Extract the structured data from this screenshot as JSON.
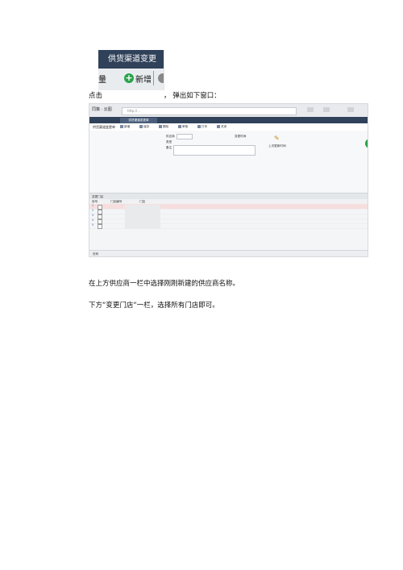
{
  "crop": {
    "tab_label": "供货渠道变更单",
    "edge_char": "量",
    "add_label": "新增",
    "plus_icon": "+"
  },
  "line1": {
    "prefix": "点击",
    "suffix": "，   弹出如下窗口："
  },
  "screenshot": {
    "brand": "同策 · 云图",
    "url": "http://...",
    "tab": "供货渠道变更单",
    "page_title": "供货渠道变更单",
    "tools": [
      "新增",
      "保存",
      "删除",
      "审核",
      "打印",
      "关闭"
    ],
    "form": {
      "supplier_label": "供应商",
      "type_label": "类型",
      "remark_label": "备注",
      "right_label": "变更时间",
      "icon_caption": "上次更新时间"
    },
    "grid_title": "变更门店",
    "grid_columns": [
      "序号",
      "门店编号",
      "门店"
    ],
    "row_numbers": [
      "1",
      "2",
      "3",
      "4",
      "5"
    ],
    "status": "页码"
  },
  "line2": "在上方供应商一栏中选择刚刚新建的供应商名称。",
  "line3": "下方“变更门店“一栏，选择所有门店即可。",
  "colors": {
    "header_navy": "#30415a",
    "accent_green": "#2ba24c",
    "selected_row": "#f7dede"
  }
}
